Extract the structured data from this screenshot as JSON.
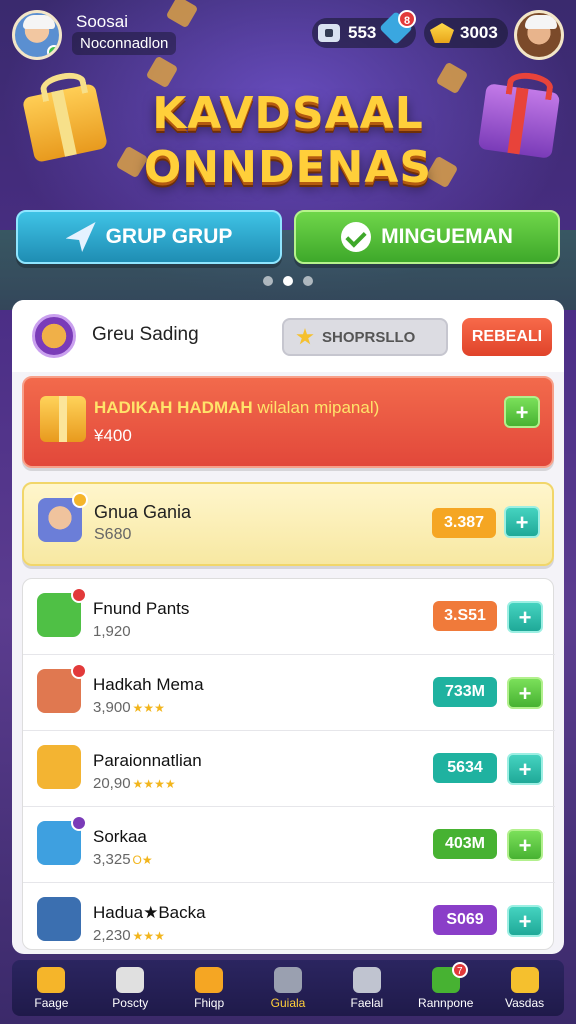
{
  "header": {
    "user_name": "Soosai",
    "user_subtitle": "Noconnadlon",
    "currency_1": "553",
    "currency_2": "3003",
    "gem_badge": "8"
  },
  "banner": {
    "title_line1": "KAVDSAAL",
    "title_line2": "ONNDENAS",
    "page_count": 3,
    "active_page": 1
  },
  "actions": {
    "left_button": "GRUP GRUP",
    "right_button": "MINGUEMAN"
  },
  "panel": {
    "title": "Greu Sading",
    "search_placeholder": "SHOPRSLLO",
    "action_button": "REBEALI"
  },
  "featured": {
    "red": {
      "title": "HADIKAH HADMAH",
      "title_extra": "wilalan mipanal)",
      "value": "¥400"
    },
    "yellow": {
      "title": "Gnua Gania",
      "value": "S680",
      "score": "3.387"
    }
  },
  "rows": [
    {
      "title": "Fnund Pants",
      "sub": "1,920",
      "stars": "",
      "score": "3.S51",
      "score_color": "#f07a3a",
      "button_style": "teal"
    },
    {
      "title": "Hadkah Mema",
      "title_star": "★",
      "sub": "3,900",
      "stars": "★★★",
      "score": "733M",
      "score_color": "#1fb2a0",
      "button_style": "green"
    },
    {
      "title": "Paraionnatlian",
      "sub": "20,90",
      "stars": "★★★★",
      "score": "5634",
      "score_color": "#1fb2a0",
      "button_style": "teal"
    },
    {
      "title": "Sorkaa",
      "title_star": "★",
      "sub": "3,325",
      "stars": "O★",
      "score": "403M",
      "score_color": "#47b232",
      "button_style": "green"
    },
    {
      "title": "Hadua★Backa",
      "title_star": "★",
      "sub": "2,230",
      "stars": "★★★",
      "score": "S069",
      "score_color": "#8a3ec8",
      "button_style": "teal"
    }
  ],
  "nav": [
    {
      "label": "Faage",
      "icon": "home-icon"
    },
    {
      "label": "Poscty",
      "icon": "camera-icon"
    },
    {
      "label": "Fhiqp",
      "icon": "coin-icon"
    },
    {
      "label": "Guiala",
      "icon": "spin-icon"
    },
    {
      "label": "Faelal",
      "icon": "person-icon"
    },
    {
      "label": "Rannpone",
      "icon": "chat-icon",
      "badge": "7"
    },
    {
      "label": "Vasdas",
      "icon": "smile-icon"
    }
  ],
  "colors": {
    "accent_gold": "#ffcf3a",
    "blue_button": "#2aa8d0",
    "green_button": "#52bd36",
    "red_featured": "#e8553f",
    "search_button": "#e8503a"
  }
}
